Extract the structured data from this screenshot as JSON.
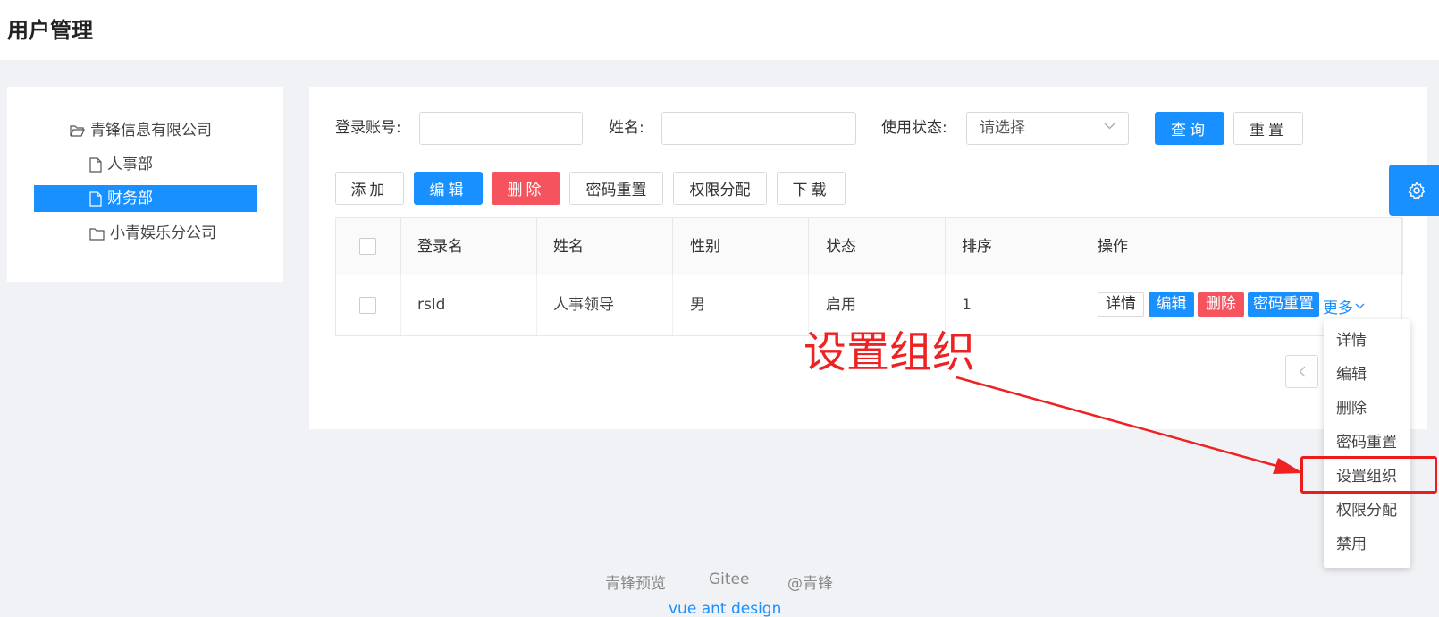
{
  "header": {
    "title": "用户管理"
  },
  "tree": {
    "root": "青锋信息有限公司",
    "children": [
      "人事部",
      "财务部",
      "小青娱乐分公司"
    ]
  },
  "search": {
    "account_label": "登录账号:",
    "name_label": "姓名:",
    "status_label": "使用状态:",
    "status_placeholder": "请选择",
    "query_button": "查询",
    "reset_button": "重置"
  },
  "toolbar": {
    "add": "添加",
    "edit": "编辑",
    "delete": "删除",
    "reset_password": "密码重置",
    "permissions": "权限分配",
    "download": "下载"
  },
  "table": {
    "columns": [
      "登录名",
      "姓名",
      "性别",
      "状态",
      "排序",
      "操作"
    ],
    "rows": [
      {
        "login": "rsld",
        "name": "人事领导",
        "gender": "男",
        "status": "启用",
        "order": "1"
      }
    ],
    "row_actions": {
      "detail": "详情",
      "edit": "编辑",
      "delete": "删除",
      "reset_password": "密码重置",
      "more": "更多"
    }
  },
  "dropdown": {
    "items": [
      "详情",
      "编辑",
      "删除",
      "密码重置",
      "设置组织",
      "权限分配",
      "禁用"
    ]
  },
  "annotation": {
    "text": "设置组织"
  },
  "footer": {
    "links": [
      "青锋预览",
      "Gitee",
      "@青锋"
    ],
    "subtitle": "vue ant design"
  },
  "colors": {
    "primary": "#1890ff",
    "danger": "#f5535d",
    "annotation": "#ee2222"
  }
}
